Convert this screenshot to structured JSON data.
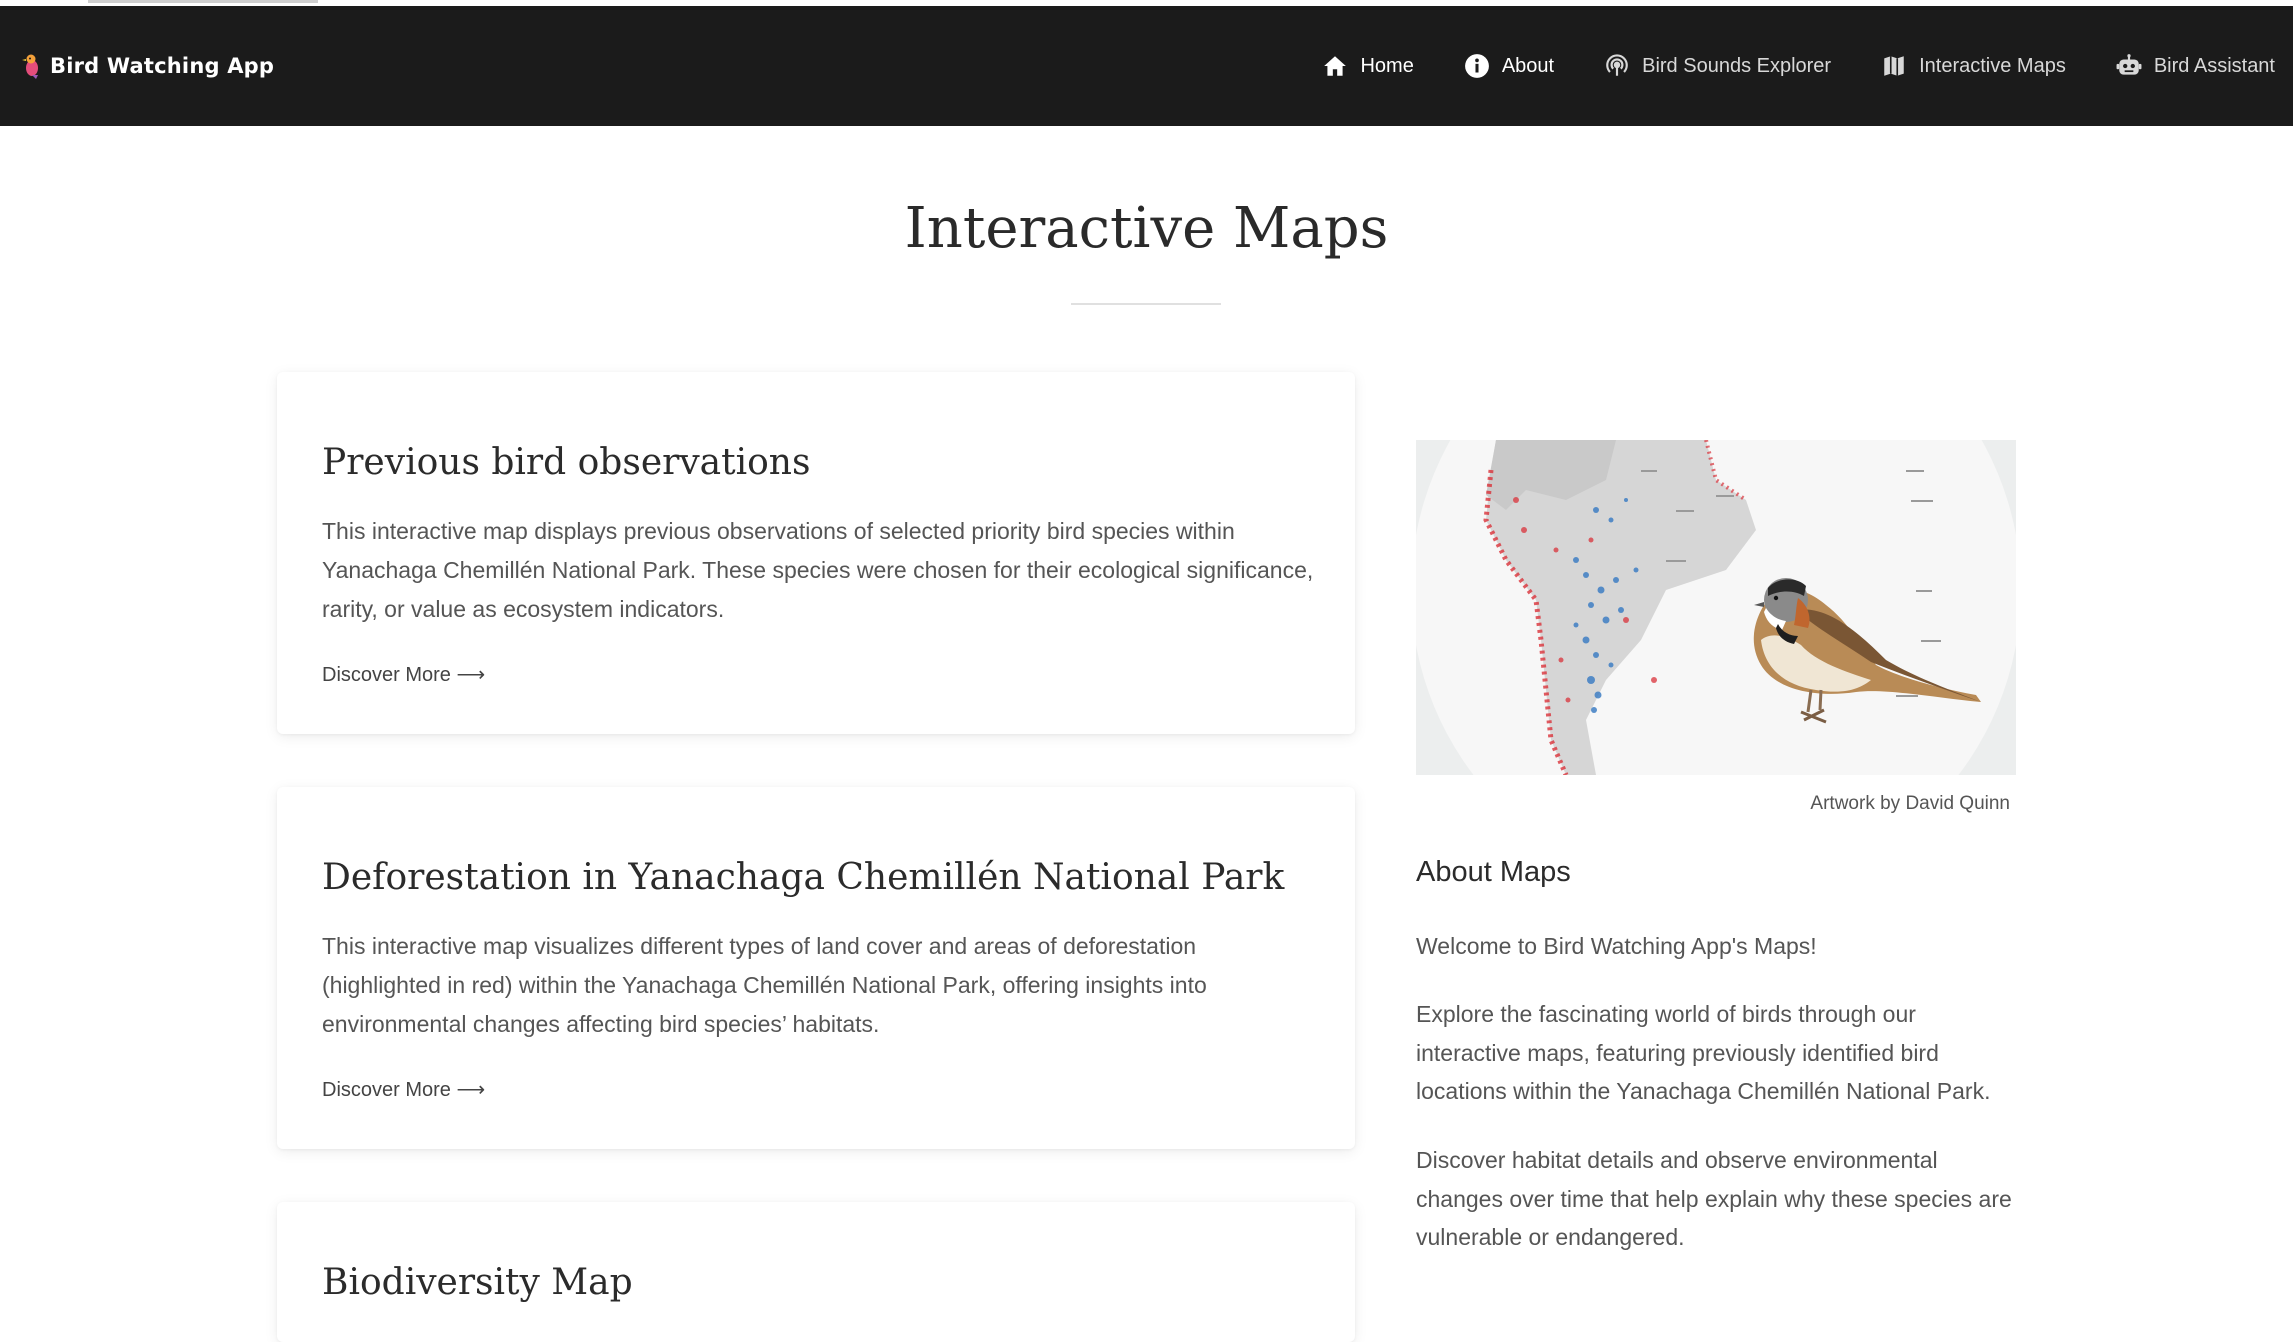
{
  "app": {
    "brand": "Bird Watching App"
  },
  "nav": {
    "items": [
      {
        "label": "Home",
        "icon": "home-icon"
      },
      {
        "label": "About",
        "icon": "info-icon"
      },
      {
        "label": "Bird Sounds Explorer",
        "icon": "podcast-icon"
      },
      {
        "label": "Interactive Maps",
        "icon": "map-icon"
      },
      {
        "label": "Bird Assistant",
        "icon": "robot-icon"
      }
    ]
  },
  "page": {
    "title": "Interactive Maps"
  },
  "cards": [
    {
      "title": "Previous bird observations",
      "text": "This interactive map displays previous observations of selected priority bird species within Yanachaga Chemillén National Park. These species were chosen for their ecological significance, rarity, or value as ecosystem indicators.",
      "link": "Discover More ⟶"
    },
    {
      "title": "Deforestation in Yanachaga Chemillén National Park",
      "text": "This interactive map visualizes different types of land cover and areas of deforestation (highlighted in red) within the Yanachaga Chemillén National Park, offering insights into environmental changes affecting bird species’ habitats.",
      "link": "Discover More ⟶"
    },
    {
      "title": "Biodiversity Map"
    }
  ],
  "sidebar": {
    "image_credit": "Artwork by David Quinn",
    "heading": "About Maps",
    "paragraphs": [
      "Welcome to Bird Watching App's Maps!",
      "Explore the fascinating world of birds through our interactive maps, featuring previously identified bird locations within the Yanachaga Chemillén National Park.",
      "Discover habitat details and observe environmental changes over time that help explain why these species are vulnerable or endangered."
    ]
  },
  "colors": {
    "navbar": "#1b1b1b",
    "accent_red": "#d9323a",
    "accent_blue": "#3f7fc4"
  }
}
